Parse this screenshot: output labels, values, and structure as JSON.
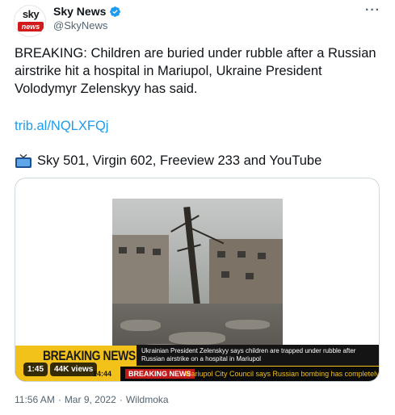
{
  "author": {
    "display_name": "Sky News",
    "handle": "@SkyNews",
    "avatar_top": "sky",
    "avatar_bottom": "news",
    "verified_icon": "verified-badge-icon",
    "brand_color": "#d31a1a"
  },
  "tweet": {
    "text": "BREAKING: Children are buried under rubble after a Russian airstrike hit a hospital in Mariupol, Ukraine President Volodymyr Zelenskyy has said.",
    "link": "trib.al/NQLXFQj",
    "channels": "Sky 501, Virgin 602, Freeview 233 and YouTube",
    "channels_icon": "television-icon",
    "more_icon": "more-options-icon"
  },
  "media": {
    "breaking_label": "BREAKING NEWS",
    "headline": "Ukrainian President Zelenskyy says children are trapped under rubble after Russian airstrike on a hospital in Mariupol",
    "ticker_time": "14:44",
    "ticker_label": "BREAKING NEWS",
    "ticker_text": "Mariupol City Council says Russian bombing has completely",
    "duration": "1:45",
    "views": "44K views"
  },
  "meta": {
    "time": "11:56 AM",
    "separator": "·",
    "date": "Mar 9, 2022",
    "source": "Wildmoka"
  },
  "colors": {
    "link": "#1d9bf0",
    "secondary_text": "#536471",
    "breaking_yellow": "#f2c21b"
  }
}
